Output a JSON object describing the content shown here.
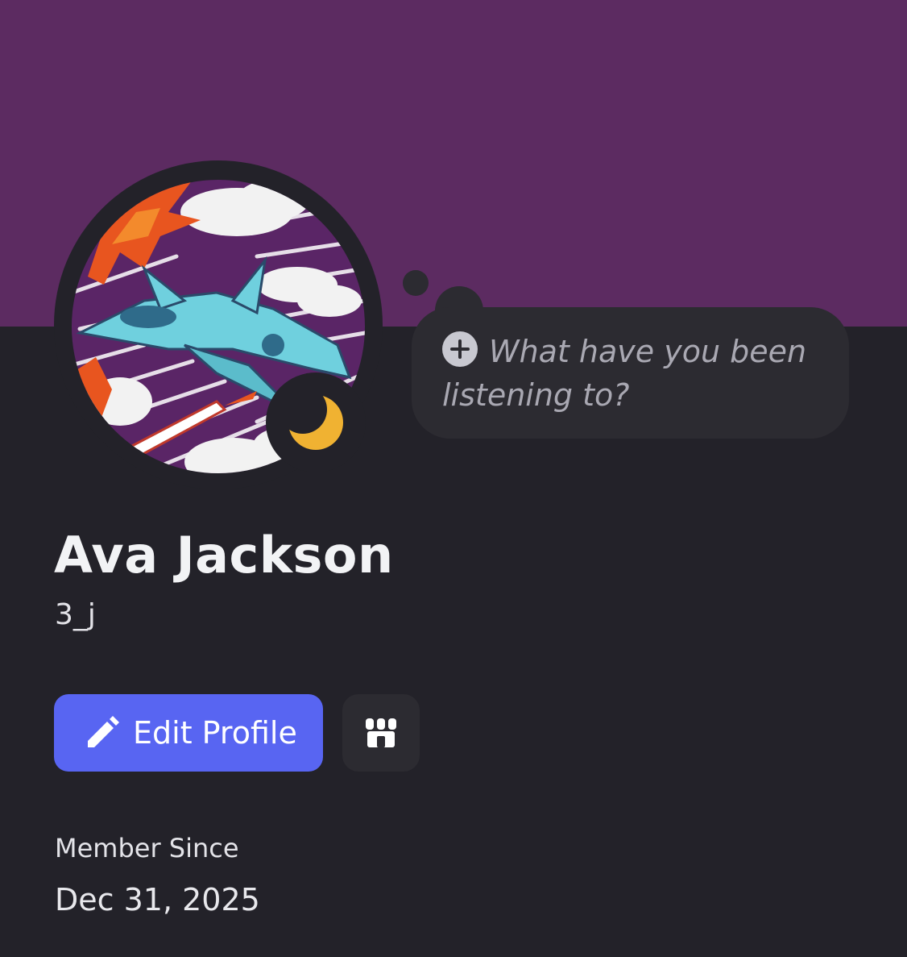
{
  "profile": {
    "banner_color": "#5c2b61",
    "avatar_icon": "fighter-jet-artwork",
    "status": "idle",
    "status_icon": "crescent-moon-icon",
    "status_color": "#f0b232",
    "display_name": "Ava Jackson",
    "username": "3_j"
  },
  "thought_bubble": {
    "icon": "plus-circle-icon",
    "placeholder": "What have you been listening to?"
  },
  "actions": {
    "edit_profile_label": "Edit Profile",
    "edit_profile_icon": "pencil-icon",
    "edit_profile_color": "#5865f2",
    "shop_icon": "shop-icon"
  },
  "member_since": {
    "label": "Member Since",
    "date": "Dec 31, 2025"
  }
}
